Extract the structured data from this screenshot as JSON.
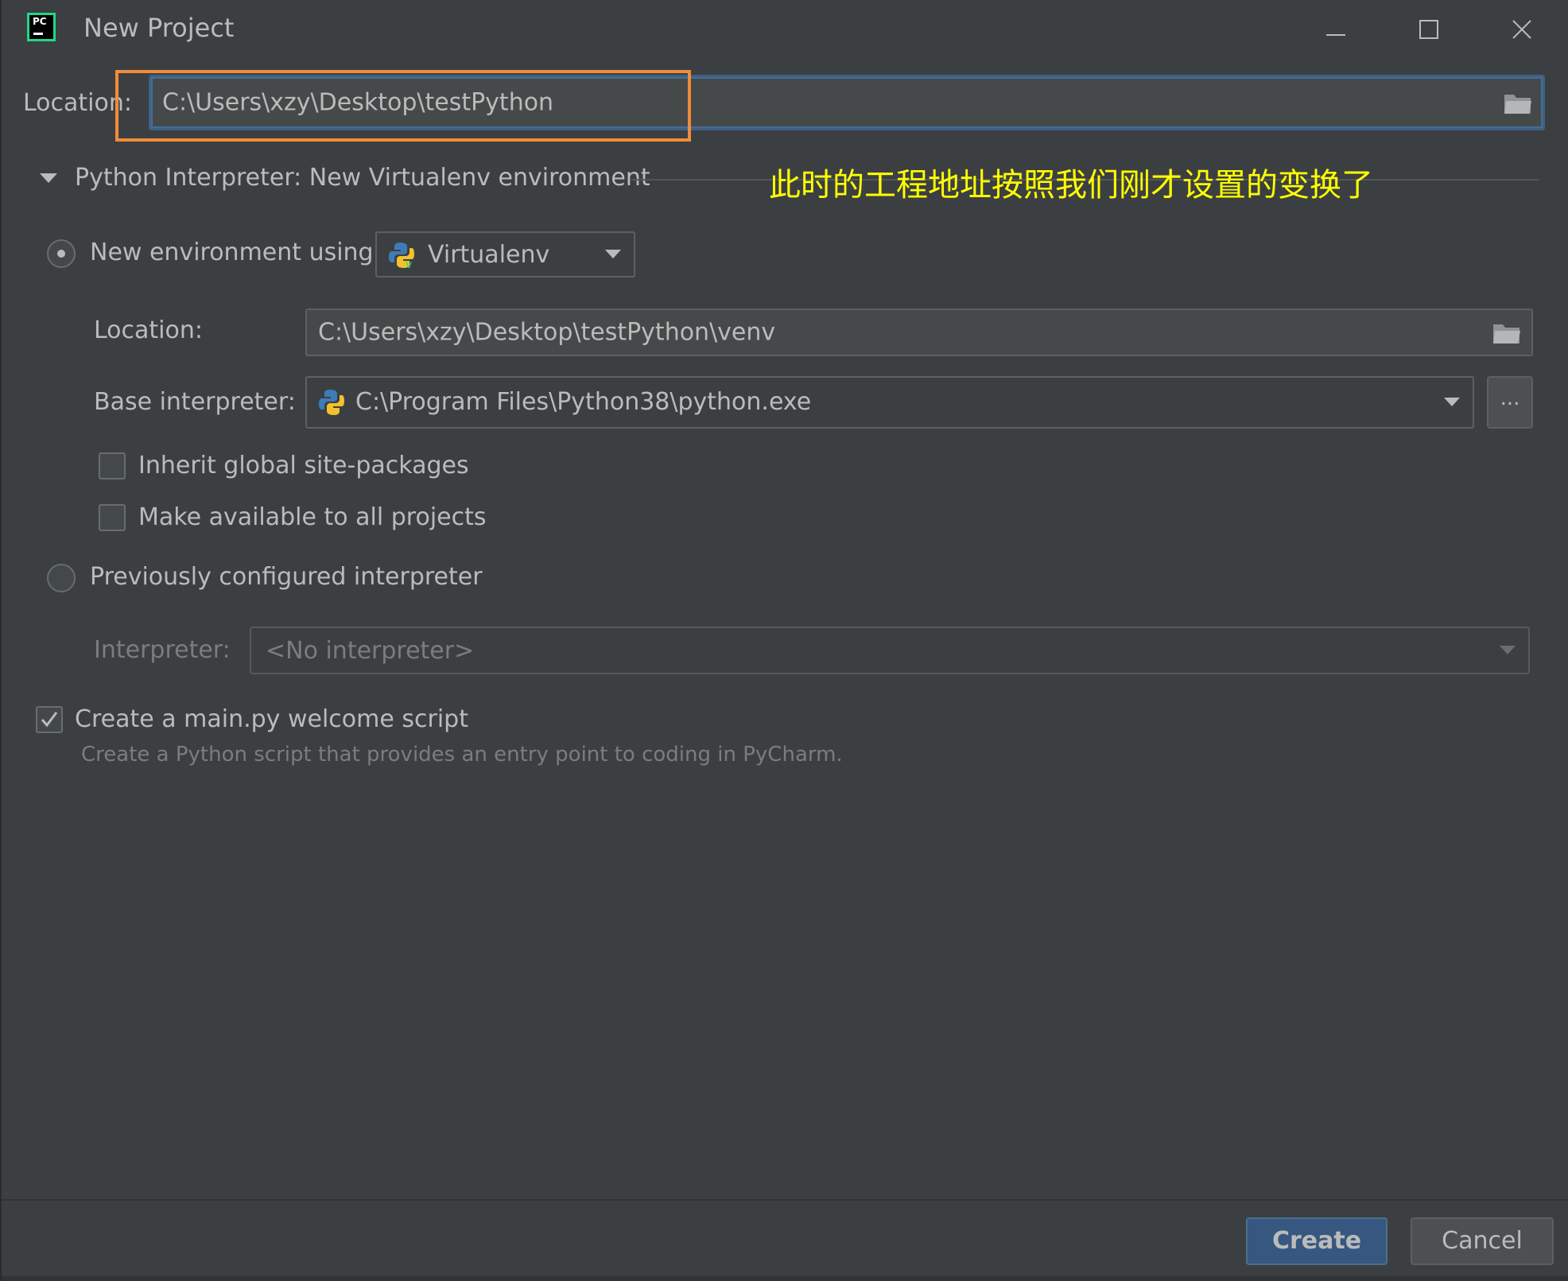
{
  "window": {
    "title": "New Project",
    "logo_text": "PC"
  },
  "project": {
    "location_label": "Location:",
    "location_value": "C:\\Users\\xzy\\Desktop\\testPython"
  },
  "interpreter_section": {
    "header": "Python Interpreter: New Virtualenv environment",
    "annotation": "此时的工程地址按照我们刚才设置的变换了"
  },
  "new_env": {
    "radio_label": "New environment using",
    "tool_selected": "Virtualenv",
    "location_label": "Location:",
    "location_value": "C:\\Users\\xzy\\Desktop\\testPython\\venv",
    "base_label": "Base interpreter:",
    "base_value": "C:\\Program Files\\Python38\\python.exe",
    "browse_label": "...",
    "inherit_label": "Inherit global site-packages",
    "make_available_label": "Make available to all projects"
  },
  "previous": {
    "radio_label": "Previously configured interpreter",
    "interpreter_label": "Interpreter:",
    "interpreter_value": "<No interpreter>"
  },
  "welcome": {
    "checkbox_label": "Create a main.py welcome script",
    "hint": "Create a Python script that provides an entry point to coding in PyCharm."
  },
  "buttons": {
    "create": "Create",
    "cancel": "Cancel"
  },
  "colors": {
    "background": "#3c3f41",
    "annotation": "#ffff00",
    "highlight": "#f08c3a",
    "primary_button": "#365880"
  }
}
